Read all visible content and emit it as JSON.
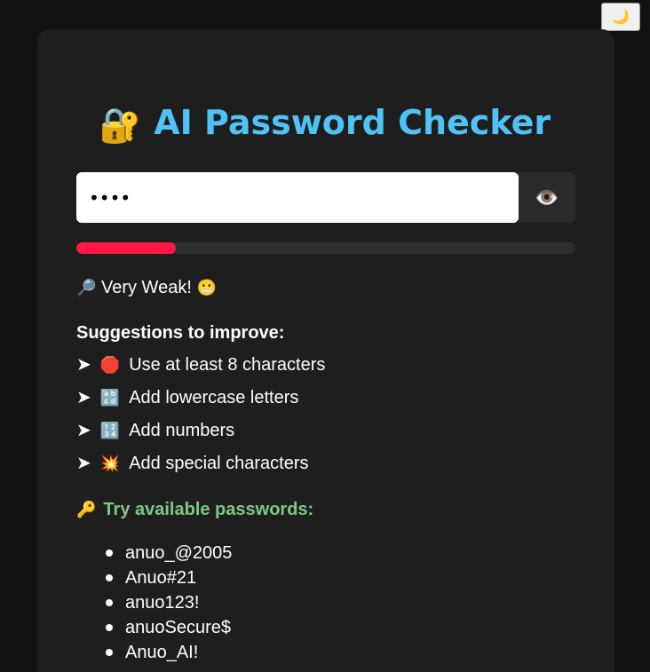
{
  "theme_toggle": {
    "icon": "crescent-moon-icon",
    "glyph": "🌙"
  },
  "header": {
    "icon": "locked-with-key-icon",
    "icon_glyph": "🔐",
    "title": "AI Password Checker"
  },
  "password_input": {
    "value": "abcd",
    "type": "password"
  },
  "visibility_toggle": {
    "icon": "eye-icon",
    "glyph": "👁️"
  },
  "strength": {
    "level_percent": 20,
    "color": "#ff1744"
  },
  "status": {
    "icon": "magnifying-glass-icon",
    "icon_glyph": "🔎",
    "label": "Very Weak!",
    "face": "😬"
  },
  "suggestions": {
    "title": "Suggestions to improve:",
    "arrow": "➤",
    "items": [
      {
        "icon": "stop-sign-icon",
        "glyph": "🛑",
        "text": "Use at least 8 characters"
      },
      {
        "icon": "lowercase-letters-icon",
        "glyph": "🔡",
        "text": "Add lowercase letters"
      },
      {
        "icon": "numbers-icon",
        "glyph": "🔢",
        "text": "Add numbers"
      },
      {
        "icon": "explosion-icon",
        "glyph": "💥",
        "text": "Add special characters"
      }
    ]
  },
  "available": {
    "icon": "key-icon",
    "icon_glyph": "🔑",
    "title": "Try available passwords:",
    "passwords": [
      "anuo_@2005",
      "Anuo#21",
      "anuo123!",
      "anuoSecure$",
      "Anuo_AI!"
    ]
  },
  "colors": {
    "background": "#121212",
    "card": "#1e1e1e",
    "title": "#4fc3f7",
    "accent_green": "#81c784",
    "weak_red": "#ff1744"
  }
}
